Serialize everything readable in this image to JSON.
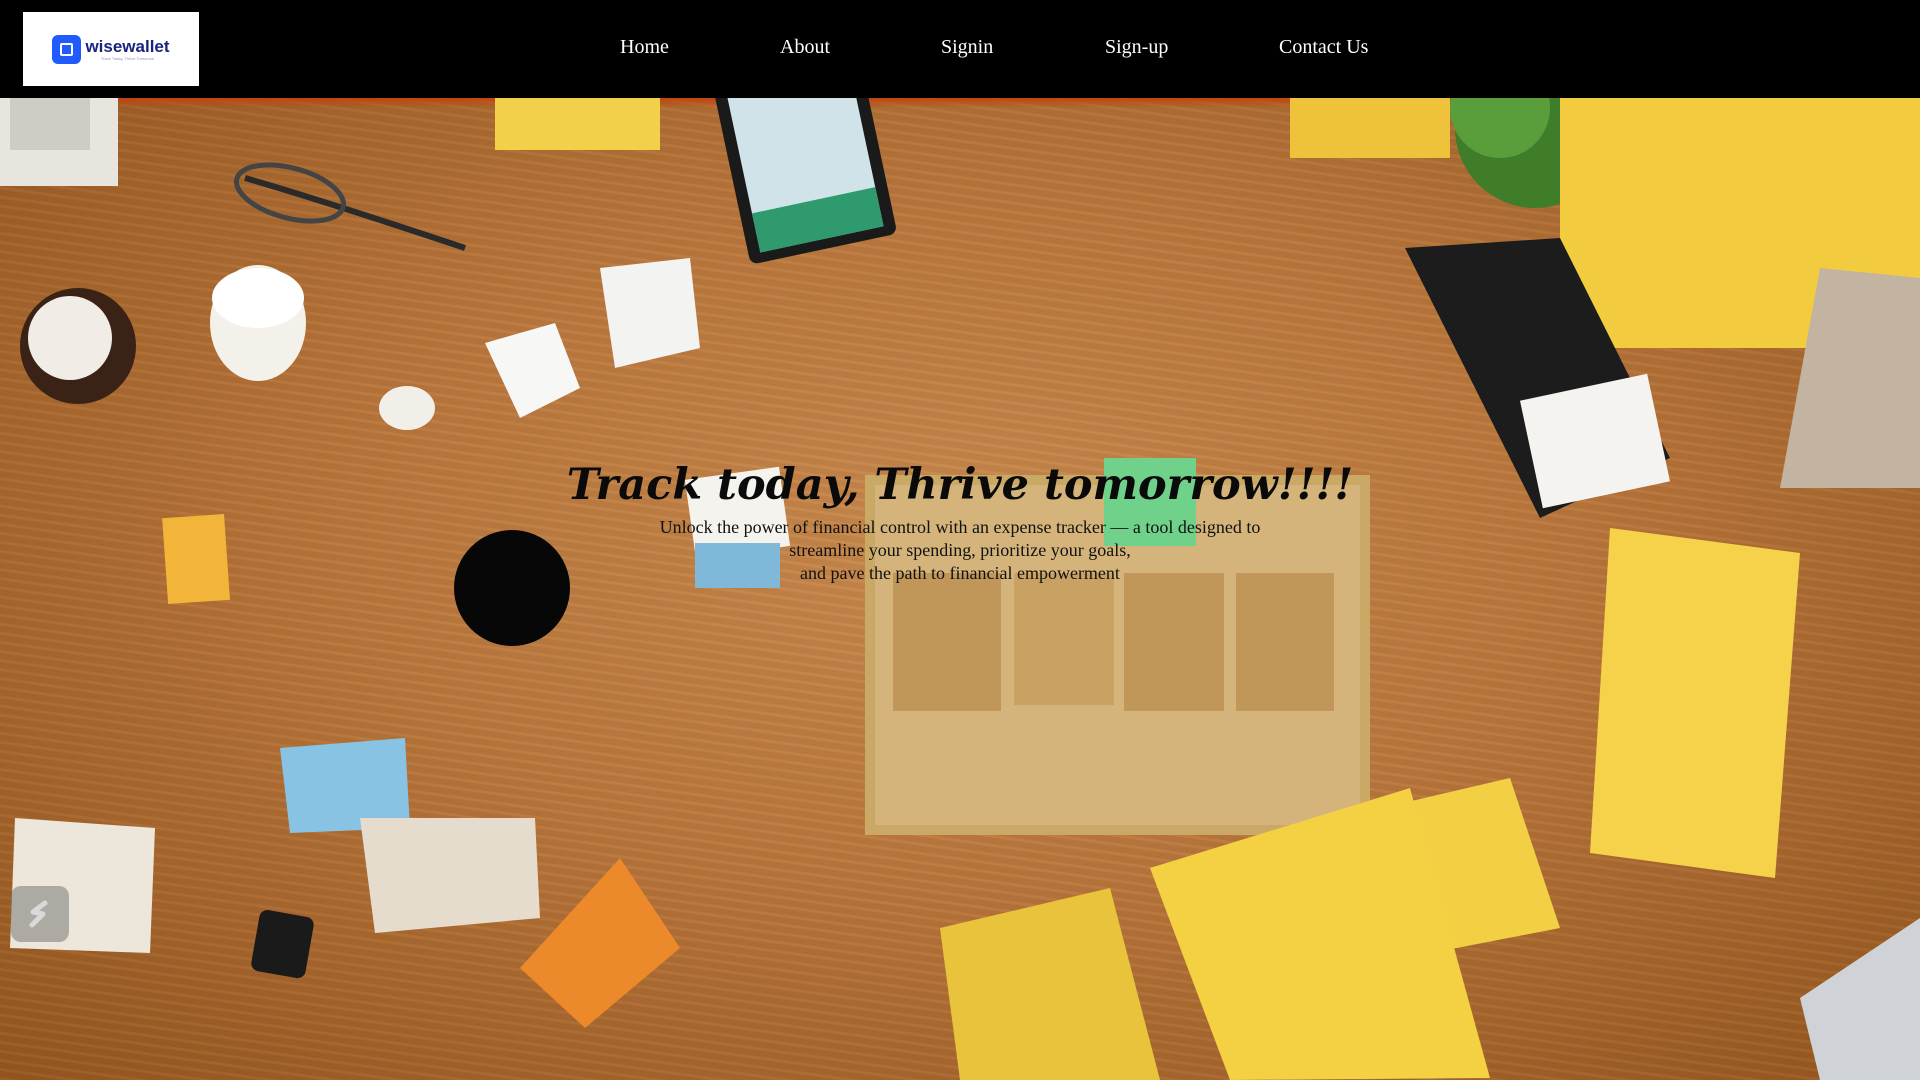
{
  "brand": {
    "name": "wisewallet",
    "tagline": "Track Today, Thrive Tomorrow",
    "logo_icon": "wallet-icon",
    "accent": "#1f5bff"
  },
  "nav": {
    "items": [
      {
        "label": "Home"
      },
      {
        "label": "About"
      },
      {
        "label": "Signin"
      },
      {
        "label": "Sign-up"
      },
      {
        "label": "Contact Us"
      }
    ]
  },
  "hero": {
    "title": "Track today, Thrive tomorrow!!!!",
    "description_lines": [
      "Unlock the power of financial control with an expense tracker — a tool designed to",
      "streamline your spending, prioritize your goals,",
      "and pave the path to financial empowerment"
    ],
    "background_image": "wooden-desk-with-papers-and-stationery"
  },
  "floating_widget": {
    "icon": "s-logo-icon"
  },
  "colors": {
    "navbar_bg": "#000000",
    "nav_text": "#ffffff",
    "hero_text": "#111111"
  }
}
